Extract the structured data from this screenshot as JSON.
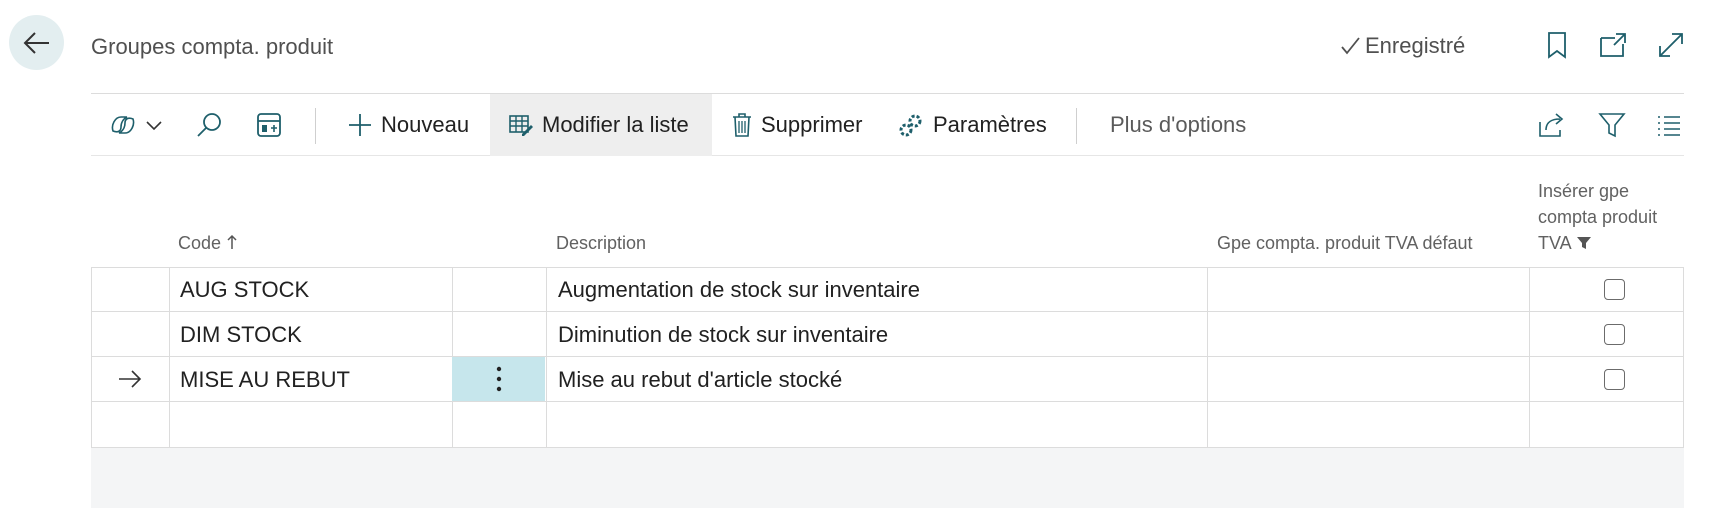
{
  "header": {
    "title": "Groupes compta. produit",
    "saved_label": "Enregistré"
  },
  "toolbar": {
    "new_label": "Nouveau",
    "edit_list_label": "Modifier la liste",
    "delete_label": "Supprimer",
    "settings_label": "Paramètres",
    "more_options_label": "Plus d'options"
  },
  "table": {
    "columns": {
      "code": "Code",
      "description": "Description",
      "default_vat_group": "Gpe compta. produit TVA défaut",
      "insert_vat_group_line1": "Insérer gpe",
      "insert_vat_group_line2": "compta produit",
      "insert_vat_group_line3": "TVA"
    },
    "rows": [
      {
        "code": "AUG STOCK",
        "description": "Augmentation de stock sur inventaire",
        "default_vat_group": "",
        "insert_vat_group": false
      },
      {
        "code": "DIM STOCK",
        "description": "Diminution de stock sur inventaire",
        "default_vat_group": "",
        "insert_vat_group": false
      },
      {
        "code": "MISE AU REBUT",
        "description": "Mise au rebut d'article stocké",
        "default_vat_group": "",
        "insert_vat_group": false,
        "selected": true
      }
    ]
  },
  "colors": {
    "accent": "#c6e6ec",
    "back_button_bg": "#e3eef0",
    "icon": "#1e5f6b"
  }
}
